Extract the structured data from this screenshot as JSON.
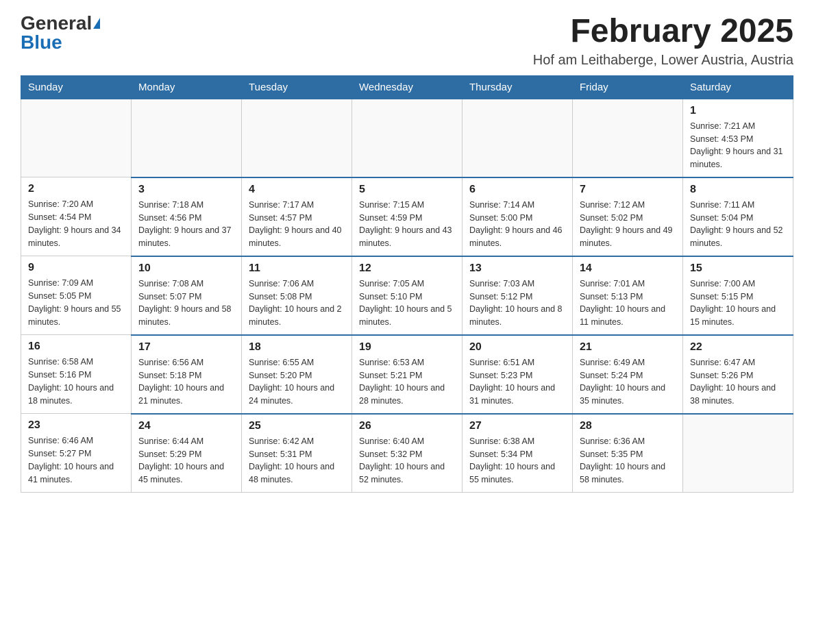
{
  "logo": {
    "general": "General",
    "blue": "Blue"
  },
  "title": "February 2025",
  "subtitle": "Hof am Leithaberge, Lower Austria, Austria",
  "weekdays": [
    "Sunday",
    "Monday",
    "Tuesday",
    "Wednesday",
    "Thursday",
    "Friday",
    "Saturday"
  ],
  "weeks": [
    [
      {
        "day": "",
        "info": ""
      },
      {
        "day": "",
        "info": ""
      },
      {
        "day": "",
        "info": ""
      },
      {
        "day": "",
        "info": ""
      },
      {
        "day": "",
        "info": ""
      },
      {
        "day": "",
        "info": ""
      },
      {
        "day": "1",
        "info": "Sunrise: 7:21 AM\nSunset: 4:53 PM\nDaylight: 9 hours and 31 minutes."
      }
    ],
    [
      {
        "day": "2",
        "info": "Sunrise: 7:20 AM\nSunset: 4:54 PM\nDaylight: 9 hours and 34 minutes."
      },
      {
        "day": "3",
        "info": "Sunrise: 7:18 AM\nSunset: 4:56 PM\nDaylight: 9 hours and 37 minutes."
      },
      {
        "day": "4",
        "info": "Sunrise: 7:17 AM\nSunset: 4:57 PM\nDaylight: 9 hours and 40 minutes."
      },
      {
        "day": "5",
        "info": "Sunrise: 7:15 AM\nSunset: 4:59 PM\nDaylight: 9 hours and 43 minutes."
      },
      {
        "day": "6",
        "info": "Sunrise: 7:14 AM\nSunset: 5:00 PM\nDaylight: 9 hours and 46 minutes."
      },
      {
        "day": "7",
        "info": "Sunrise: 7:12 AM\nSunset: 5:02 PM\nDaylight: 9 hours and 49 minutes."
      },
      {
        "day": "8",
        "info": "Sunrise: 7:11 AM\nSunset: 5:04 PM\nDaylight: 9 hours and 52 minutes."
      }
    ],
    [
      {
        "day": "9",
        "info": "Sunrise: 7:09 AM\nSunset: 5:05 PM\nDaylight: 9 hours and 55 minutes."
      },
      {
        "day": "10",
        "info": "Sunrise: 7:08 AM\nSunset: 5:07 PM\nDaylight: 9 hours and 58 minutes."
      },
      {
        "day": "11",
        "info": "Sunrise: 7:06 AM\nSunset: 5:08 PM\nDaylight: 10 hours and 2 minutes."
      },
      {
        "day": "12",
        "info": "Sunrise: 7:05 AM\nSunset: 5:10 PM\nDaylight: 10 hours and 5 minutes."
      },
      {
        "day": "13",
        "info": "Sunrise: 7:03 AM\nSunset: 5:12 PM\nDaylight: 10 hours and 8 minutes."
      },
      {
        "day": "14",
        "info": "Sunrise: 7:01 AM\nSunset: 5:13 PM\nDaylight: 10 hours and 11 minutes."
      },
      {
        "day": "15",
        "info": "Sunrise: 7:00 AM\nSunset: 5:15 PM\nDaylight: 10 hours and 15 minutes."
      }
    ],
    [
      {
        "day": "16",
        "info": "Sunrise: 6:58 AM\nSunset: 5:16 PM\nDaylight: 10 hours and 18 minutes."
      },
      {
        "day": "17",
        "info": "Sunrise: 6:56 AM\nSunset: 5:18 PM\nDaylight: 10 hours and 21 minutes."
      },
      {
        "day": "18",
        "info": "Sunrise: 6:55 AM\nSunset: 5:20 PM\nDaylight: 10 hours and 24 minutes."
      },
      {
        "day": "19",
        "info": "Sunrise: 6:53 AM\nSunset: 5:21 PM\nDaylight: 10 hours and 28 minutes."
      },
      {
        "day": "20",
        "info": "Sunrise: 6:51 AM\nSunset: 5:23 PM\nDaylight: 10 hours and 31 minutes."
      },
      {
        "day": "21",
        "info": "Sunrise: 6:49 AM\nSunset: 5:24 PM\nDaylight: 10 hours and 35 minutes."
      },
      {
        "day": "22",
        "info": "Sunrise: 6:47 AM\nSunset: 5:26 PM\nDaylight: 10 hours and 38 minutes."
      }
    ],
    [
      {
        "day": "23",
        "info": "Sunrise: 6:46 AM\nSunset: 5:27 PM\nDaylight: 10 hours and 41 minutes."
      },
      {
        "day": "24",
        "info": "Sunrise: 6:44 AM\nSunset: 5:29 PM\nDaylight: 10 hours and 45 minutes."
      },
      {
        "day": "25",
        "info": "Sunrise: 6:42 AM\nSunset: 5:31 PM\nDaylight: 10 hours and 48 minutes."
      },
      {
        "day": "26",
        "info": "Sunrise: 6:40 AM\nSunset: 5:32 PM\nDaylight: 10 hours and 52 minutes."
      },
      {
        "day": "27",
        "info": "Sunrise: 6:38 AM\nSunset: 5:34 PM\nDaylight: 10 hours and 55 minutes."
      },
      {
        "day": "28",
        "info": "Sunrise: 6:36 AM\nSunset: 5:35 PM\nDaylight: 10 hours and 58 minutes."
      },
      {
        "day": "",
        "info": ""
      }
    ]
  ]
}
